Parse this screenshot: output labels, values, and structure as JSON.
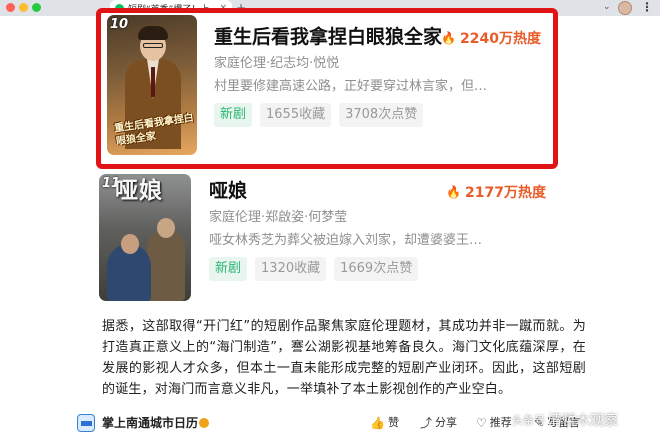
{
  "browser": {
    "tab_title": "短剧“首秀”爆了！上…",
    "tab_close": "×",
    "new_tab": "+",
    "profile_chevron": "⌄",
    "menu": "⋮",
    "colors": {
      "close": "#fe5f57",
      "minimize": "#febc2e",
      "maximize": "#28c840",
      "wechat_icon": "#07c160"
    }
  },
  "dramas": [
    {
      "rank": "10",
      "title": "重生后看我拿捏白眼狼全家",
      "heat": "2240万热度",
      "genre": "家庭伦理·纪志均·悦悦",
      "synopsis": "村里要修建高速公路，正好要穿过林言家，但…",
      "tags": [
        "新剧",
        "1655收藏",
        "3708次点赞"
      ],
      "poster_text": "重生后看我拿捏白眼狼全家",
      "highlighted": true
    },
    {
      "rank": "11",
      "title": "哑娘",
      "heat": "2177万热度",
      "genre": "家庭伦理·郑啟姿·何梦莹",
      "synopsis": "哑女林秀芝为葬父被迫嫁入刘家，却遭婆婆王…",
      "tags": [
        "新剧",
        "1320收藏",
        "1669次点赞"
      ],
      "poster_text": "哑娘",
      "highlighted": false
    }
  ],
  "article": {
    "paragraph": "据悉，这部取得“开门红”的短剧作品聚焦家庭伦理题材，其成功并非一蹴而就。为打造真正意义上的“海门制造”，謇公湖影视基地筹备良久。海门文化底蕴深厚，在发展的影视人才众多，但本土一直未能形成完整的短剧产业闭环。因此，这部短剧的诞生，对海门而言意义非凡，一举填补了本土影视创作的产业空白。"
  },
  "footer": {
    "account_name": "掌上南通城市日历",
    "like": "赞",
    "share": "分享",
    "recommend": "推荐",
    "comment": "写留言",
    "watermark": "清哲木观察",
    "watermark_prefix": "头条号"
  },
  "colors": {
    "highlight_border": "#e01414",
    "heat": "#e85c2a",
    "new_tag": "#2bb673"
  }
}
